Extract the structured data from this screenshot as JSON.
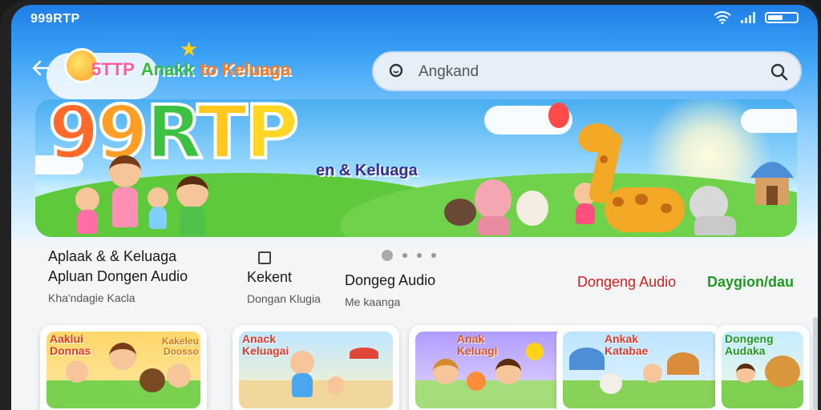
{
  "status_bar": {
    "title": "999RTP"
  },
  "header": {
    "logo_text_a": "5TTP",
    "logo_text_b": "Anakk",
    "logo_text_c": "to Keluaga",
    "search": {
      "placeholder": "Angkand",
      "value": ""
    }
  },
  "banner": {
    "title_chars": [
      "9",
      "9",
      "R",
      "T",
      "P"
    ],
    "subtitle": "en & Keluaga"
  },
  "carousel": {
    "pages": 4,
    "active_index": 0
  },
  "nav": [
    {
      "line1": "Aplaak & & Keluaga",
      "line2": "Apluan Dongen Audio",
      "line3": "Kha'ndagie Kacla"
    },
    {
      "line1": "Kekent",
      "line3": "Dongan Klugia"
    },
    {
      "line1": "Dongeg Audio",
      "line3": "Me kaanga"
    },
    {
      "line1": "Dongeng Audio"
    },
    {
      "line1": "Daygion/dau"
    }
  ],
  "cards": [
    {
      "title_a": "Aaklui\nDonnas",
      "title_b": "Kakeleu\nDoosso"
    },
    {
      "title_a": "Anack\nKeluagai"
    },
    {
      "title_a": "Anak\nKeluagi"
    },
    {
      "title_a": "Ankak\nKatabae"
    },
    {
      "title_a": "Dongeng\nAudaka"
    }
  ],
  "colors": {
    "accent_blue": "#1f7ee6",
    "nav_red": "#d42020",
    "nav_green": "#1f9a1f"
  }
}
